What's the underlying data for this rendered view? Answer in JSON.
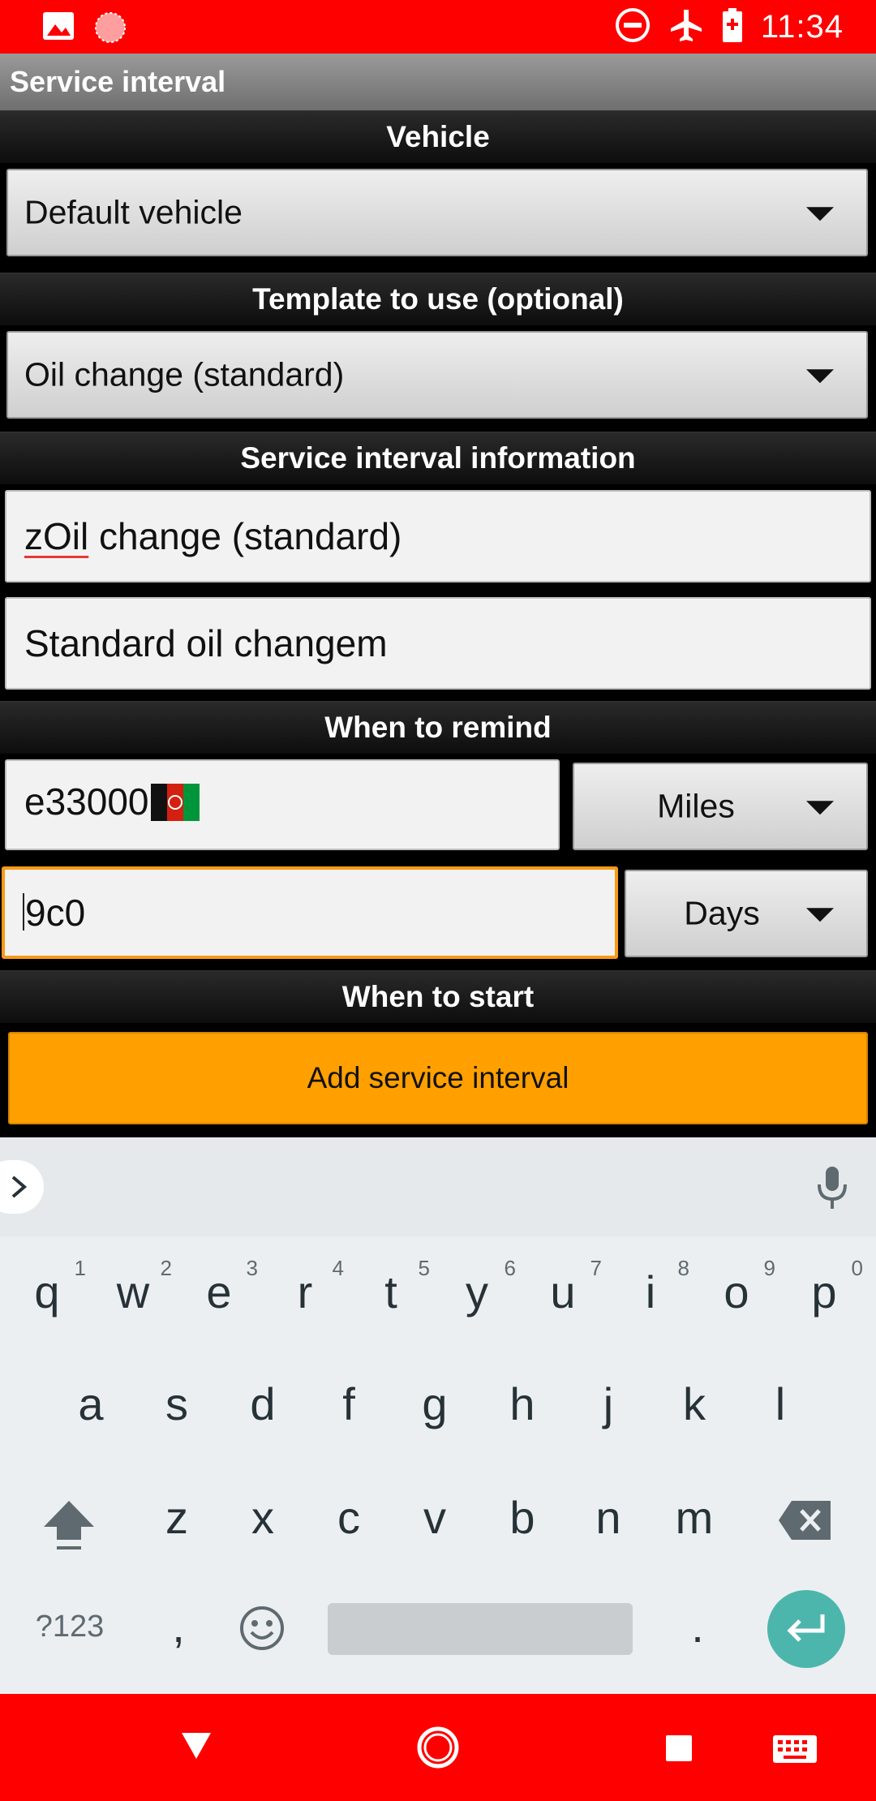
{
  "status_bar": {
    "time": "11:34",
    "left_icons": [
      "image-icon",
      "sun-icon"
    ],
    "right_icons": [
      "do-not-disturb-icon",
      "airplane-icon",
      "battery-icon"
    ]
  },
  "title": "Service interval",
  "sections": {
    "vehicle": "Vehicle",
    "template": "Template to use (optional)",
    "info": "Service interval information",
    "remind": "When to remind",
    "start": "When to start"
  },
  "vehicle_spinner": {
    "value": "Default vehicle"
  },
  "template_spinner": {
    "value": "Oil change (standard)"
  },
  "name_field": {
    "misspelled": "zOil",
    "rest": " change (standard)"
  },
  "description_field": {
    "value": "Standard oil changem"
  },
  "distance_field": {
    "value": "e33000",
    "flag": "Afghanistan flag emoji"
  },
  "distance_unit": {
    "value": "Miles"
  },
  "time_field": {
    "value": "9c0"
  },
  "time_unit": {
    "value": "Days"
  },
  "add_button": {
    "label": "Add service interval"
  },
  "keyboard": {
    "row1": [
      {
        "k": "q",
        "n": "1"
      },
      {
        "k": "w",
        "n": "2"
      },
      {
        "k": "e",
        "n": "3"
      },
      {
        "k": "r",
        "n": "4"
      },
      {
        "k": "t",
        "n": "5"
      },
      {
        "k": "y",
        "n": "6"
      },
      {
        "k": "u",
        "n": "7"
      },
      {
        "k": "i",
        "n": "8"
      },
      {
        "k": "o",
        "n": "9"
      },
      {
        "k": "p",
        "n": "0"
      }
    ],
    "row2": [
      "a",
      "s",
      "d",
      "f",
      "g",
      "h",
      "j",
      "k",
      "l"
    ],
    "row3": [
      "z",
      "x",
      "c",
      "v",
      "b",
      "n",
      "m"
    ],
    "symbols_label": "?123",
    "comma": ",",
    "period": "."
  },
  "colors": {
    "status_bar": "#ff0000",
    "accent": "#ffa000",
    "focus_border": "#f79a18",
    "enter_key": "#4db6ac"
  }
}
